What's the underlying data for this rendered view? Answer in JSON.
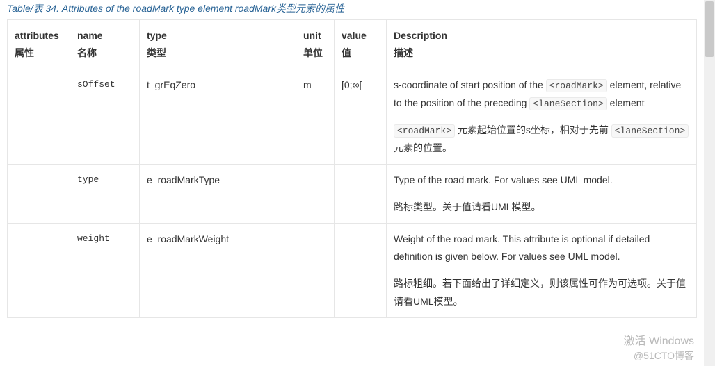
{
  "caption": "Table/表 34. Attributes of the roadMark type element roadMark类型元素的属性",
  "headers": {
    "attributes_en": "attributes",
    "attributes_zh": "属性",
    "name_en": "name",
    "name_zh": "名称",
    "type_en": "type",
    "type_zh": "类型",
    "unit_en": "unit",
    "unit_zh": "单位",
    "value_en": "value",
    "value_zh": "值",
    "desc_en": "Description",
    "desc_zh": "描述"
  },
  "rows": [
    {
      "attributes": "",
      "name": "sOffset",
      "type": "t_grEqZero",
      "unit": "m",
      "value": "[0;∞[",
      "desc_en_pre": "s-coordinate of start position of the ",
      "desc_en_code1": "<roadMark>",
      "desc_en_mid": " element, relative to the position of the preceding ",
      "desc_en_code2": "<laneSection>",
      "desc_en_post": " element",
      "desc_zh_code1": "<roadMark>",
      "desc_zh_mid": " 元素起始位置的s坐标，相对于先前 ",
      "desc_zh_code2": "<laneSection>",
      "desc_zh_post": " 元素的位置。"
    },
    {
      "attributes": "",
      "name": "type",
      "type": "e_roadMarkType",
      "unit": "",
      "value": "",
      "desc_en": "Type of the road mark. For values see UML model.",
      "desc_zh": "路标类型。关于值请看UML模型。"
    },
    {
      "attributes": "",
      "name": "weight",
      "type": "e_roadMarkWeight",
      "unit": "",
      "value": "",
      "desc_en": "Weight of the road mark. This attribute is optional if detailed definition is given below. For values see UML model.",
      "desc_zh": "路标粗细。若下面给出了详细定义，则该属性可作为可选项。关于值请看UML模型。"
    }
  ],
  "watermark": {
    "line1": "激活 Windows",
    "line2_tail": "@51CTO博客"
  }
}
